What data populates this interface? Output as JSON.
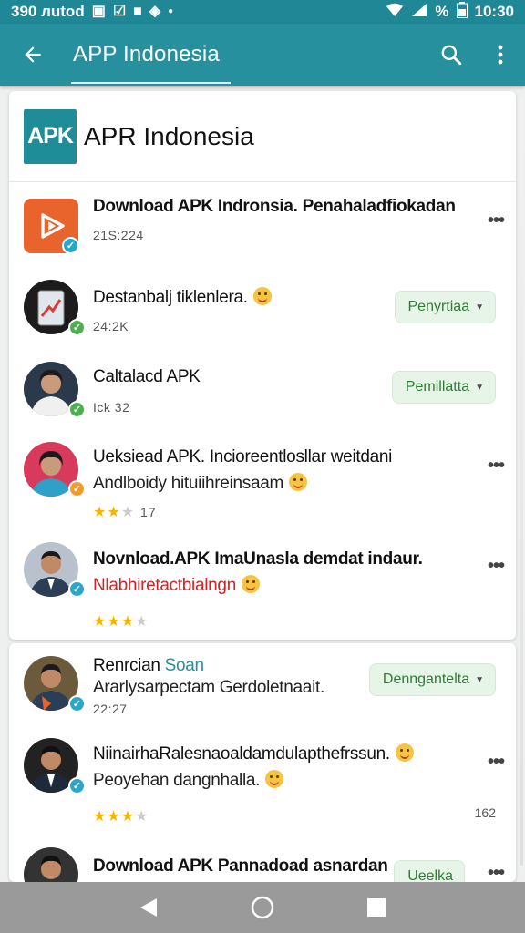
{
  "status_bar": {
    "left_text": "390 лutod",
    "battery": "%",
    "time": "10:30"
  },
  "app_bar": {
    "title": "APP Indonesia"
  },
  "header": {
    "logo_text": "APK",
    "title": "APR Indonesia"
  },
  "items": [
    {
      "title": "Download APK Indronsia. Penahaladfiokadan",
      "meta": "21S:224"
    },
    {
      "title": "Destanbalj tiklenlera.",
      "meta": "24:2K",
      "chip": "Penyrtiaa"
    },
    {
      "title": "Caltalacd APK",
      "meta": "Ick 32",
      "chip": "Pemillatta"
    },
    {
      "title": "Ueksiead APK. Incioreentlosllar weitdani",
      "subtitle": "Andlboidy hituiihreinsaam",
      "rating_count": "17"
    },
    {
      "title": "Novnload.APK ImaUnasla demdat indaur.",
      "subtitle": "Nlabhiretactbialngn",
      "rating": "3.5"
    },
    {
      "title": "Renrcian",
      "title_accent": "Soan",
      "subtitle": "Ararlysarpectam Gerdoletnaait.",
      "meta": "22:27",
      "chip": "Denngantelta"
    },
    {
      "title": "NiinairhaRalesnaoaldamdulapthefrssun.",
      "subtitle": "Peoyehan dangnhalla.",
      "side_count": "162"
    },
    {
      "title": "Download APK Pannadoad asnardan",
      "chip": "Ueelka"
    }
  ],
  "colors": {
    "accent": "#26909e",
    "chip_bg": "#e7f4e8",
    "chip_text": "#2e7d32",
    "star": "#f4b400"
  }
}
